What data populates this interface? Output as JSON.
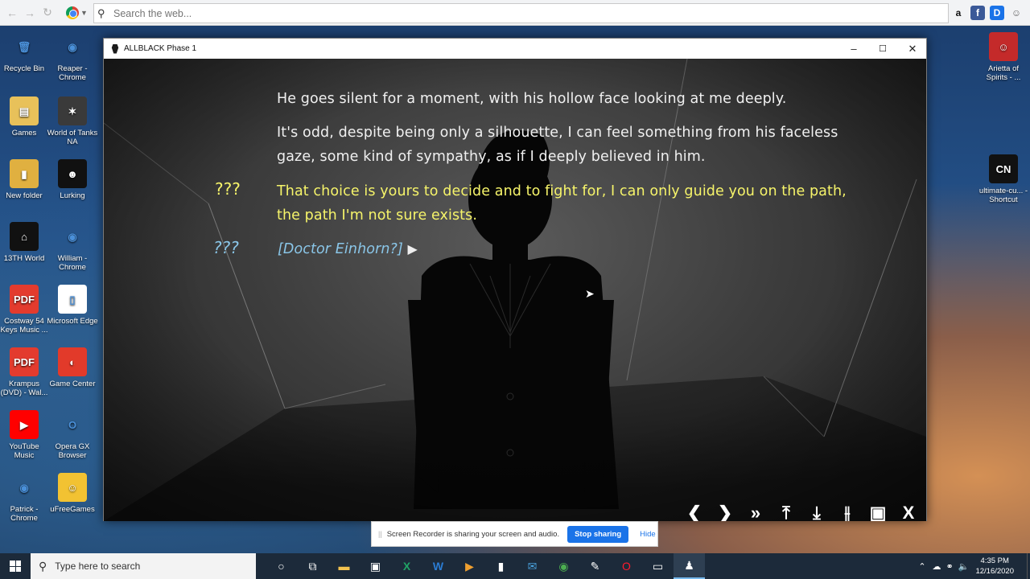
{
  "browser": {
    "search_placeholder": "Search the web...",
    "nav": [
      "back-icon",
      "forward-icon",
      "refresh-icon"
    ],
    "extensions": [
      {
        "name": "amazon-icon",
        "glyph": "a",
        "color": "#111111",
        "bg": "transparent"
      },
      {
        "name": "facebook-icon",
        "glyph": "f",
        "color": "#ffffff",
        "bg": "#3b5998"
      },
      {
        "name": "d-extension-icon",
        "glyph": "D",
        "color": "#ffffff",
        "bg": "#1a73e8"
      },
      {
        "name": "user-icon",
        "glyph": "☺",
        "color": "#666666",
        "bg": "transparent"
      }
    ]
  },
  "desktop": {
    "icons_left": [
      {
        "label": "Recycle Bin",
        "glyph": "🗑",
        "bg": "transparent"
      },
      {
        "label": "Reaper - Chrome",
        "glyph": "◉",
        "bg": "transparent"
      },
      {
        "label": "Games",
        "glyph": "▤",
        "bg": "#e8c15a"
      },
      {
        "label": "World of Tanks NA",
        "glyph": "✶",
        "bg": "#3a3a3a"
      },
      {
        "label": "New folder",
        "glyph": "▮",
        "bg": "#e0b040"
      },
      {
        "label": "Lurking",
        "glyph": "☻",
        "bg": "#111111"
      },
      {
        "label": "13TH World",
        "glyph": "⌂",
        "bg": "#111111"
      },
      {
        "label": "William - Chrome",
        "glyph": "◉",
        "bg": "transparent"
      },
      {
        "label": "Costway 54 Keys Music ...",
        "glyph": "PDF",
        "bg": "#e33b2e"
      },
      {
        "label": "Microsoft Edge",
        "glyph": "▯",
        "bg": "#ffffff"
      },
      {
        "label": "Krampus (DVD) - Wal...",
        "glyph": "PDF",
        "bg": "#e33b2e"
      },
      {
        "label": "Game Center",
        "glyph": "◐",
        "bg": "#e23a2a"
      },
      {
        "label": "YouTube Music",
        "glyph": "▶",
        "bg": "#ff0000"
      },
      {
        "label": "Opera GX Browser",
        "glyph": "O",
        "bg": "transparent"
      },
      {
        "label": "Patrick - Chrome",
        "glyph": "◉",
        "bg": "transparent"
      },
      {
        "label": "uFreeGames",
        "glyph": "☺",
        "bg": "#f2c232"
      }
    ],
    "icons_right": [
      {
        "label": "Arietta of Spirits - ...",
        "glyph": "☺",
        "bg": "#c42a2a"
      },
      {
        "label": "ultimate-cu... - Shortcut",
        "glyph": "CN",
        "bg": "#111111"
      }
    ]
  },
  "window": {
    "title": "ALLBLACK Phase 1",
    "controls": [
      "minimize-icon",
      "maximize-icon",
      "close-icon"
    ]
  },
  "dialogue": {
    "line1": "He goes silent for a moment, with his hollow face looking at me deeply.",
    "line2": "It's odd, despite being only a silhouette, I can feel something from his faceless gaze, some kind of sympathy, as if I deeply believed in him.",
    "speaker3": "???",
    "line3": "That choice is yours to decide and to fight for, I can only guide you on the path, the path I'm not sure exists.",
    "speaker4": "???",
    "line4": "[Doctor Einhorn?]"
  },
  "game_menu": [
    {
      "name": "back-icon",
      "glyph": "❮"
    },
    {
      "name": "forward-icon",
      "glyph": "❯"
    },
    {
      "name": "skip-icon",
      "glyph": "»"
    },
    {
      "name": "save-icon",
      "glyph": "⤒"
    },
    {
      "name": "load-icon",
      "glyph": "⤓"
    },
    {
      "name": "settings-sliders-icon",
      "glyph": "⫲"
    },
    {
      "name": "quicksave-icon",
      "glyph": "▣"
    },
    {
      "name": "exit-icon",
      "glyph": "X"
    }
  ],
  "share_banner": {
    "message": "Screen Recorder is sharing your screen and audio.",
    "stop_label": "Stop sharing",
    "hide_label": "Hide"
  },
  "taskbar": {
    "search_placeholder": "Type here to search",
    "apps": [
      "cortana-icon",
      "task-view-icon",
      "file-explorer-icon",
      "store-icon",
      "excel-icon",
      "word-icon",
      "media-icon",
      "mic-icon",
      "mail-icon",
      "chrome-icon",
      "feather-icon",
      "opera-icon",
      "screen-recorder-icon",
      "allblack-icon"
    ],
    "time": "4:35 PM",
    "date": "12/16/2020"
  }
}
